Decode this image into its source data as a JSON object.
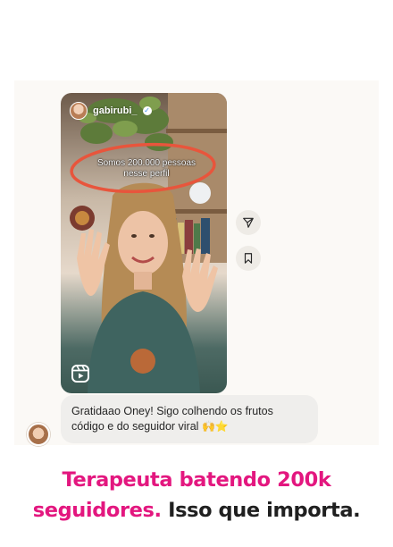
{
  "post": {
    "username": "gabirubi_",
    "overlay_text": "Somos 200.000 pessoas nesse perfil",
    "comment": {
      "text": "Gratidaao Oney! Sigo colhendo os frutos código e do seguidor viral",
      "emojis": "🙌⭐"
    }
  },
  "caption": {
    "highlight": "Terapeuta batendo 200k seguidores.",
    "rest": "Isso que importa."
  },
  "colors": {
    "accent_pink": "#e3177f",
    "circle_annotation": "#e8553c"
  },
  "icons": {
    "send": "paper-plane-icon",
    "save": "bookmark-icon",
    "reels": "reels-icon"
  }
}
